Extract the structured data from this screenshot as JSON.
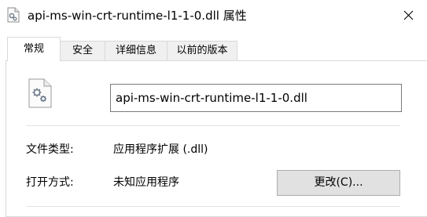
{
  "window": {
    "title": "api-ms-win-crt-runtime-l1-1-0.dll 属性",
    "icon": "dll-file-icon",
    "close_icon": "close-icon"
  },
  "tabs": [
    {
      "label": "常规",
      "active": true
    },
    {
      "label": "安全",
      "active": false
    },
    {
      "label": "详细信息",
      "active": false
    },
    {
      "label": "以前的版本",
      "active": false
    }
  ],
  "general": {
    "file_icon": "dll-file-gear-icon",
    "filename": "api-ms-win-crt-runtime-l1-1-0.dll",
    "file_type_label": "文件类型:",
    "file_type_value": "应用程序扩展 (.dll)",
    "opens_with_label": "打开方式:",
    "opens_with_value": "未知应用程序",
    "change_button": "更改(C)..."
  }
}
